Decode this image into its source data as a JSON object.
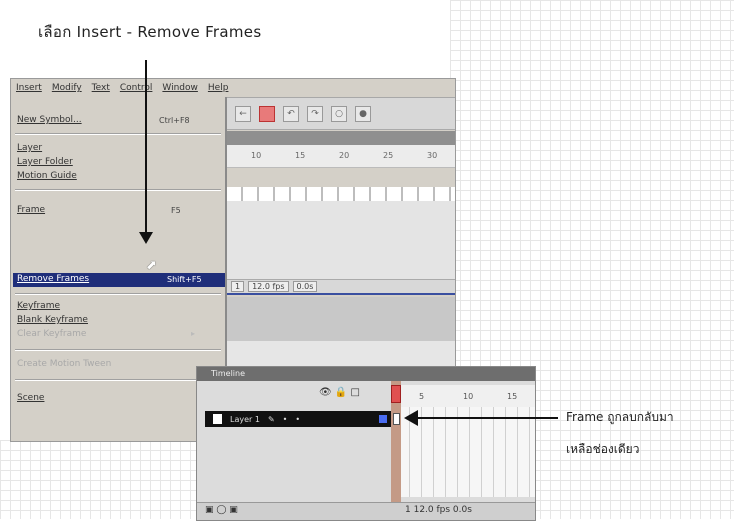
{
  "caption_top": "เลือก Insert - Remove Frames",
  "menubar": [
    "Insert",
    "Modify",
    "Text",
    "Control",
    "Window",
    "Help"
  ],
  "menu_items": {
    "new_symbol": "New Symbol...",
    "new_symbol_shortcut": "Ctrl+F8",
    "layer": "Layer",
    "layer_folder": "Layer Folder",
    "motion_guide": "Motion Guide",
    "frame": "Frame",
    "frame_shortcut": "F5",
    "remove_frames": "Remove Frames",
    "remove_frames_shortcut": "Shift+F5",
    "keyframe": "Keyframe",
    "blank_keyframe": "Blank Keyframe",
    "clear_keyframe": "Clear Keyframe",
    "create_motion_tween": "Create Motion Tween",
    "scene": "Scene"
  },
  "ruler_labels": [
    "10",
    "15",
    "20",
    "25",
    "30"
  ],
  "status_fps": "12.0 fps",
  "status_time": "0.0s",
  "status_frame": "1",
  "panel": {
    "title": "Timeline",
    "layer_name": "Layer 1",
    "ruler_labels": [
      "5",
      "10",
      "15"
    ],
    "bottom_right": "1  12.0 fps  0.0s"
  },
  "note_line1": "Frame ถูกลบกลับมา",
  "note_line2": "เหลือช่องเดียว"
}
